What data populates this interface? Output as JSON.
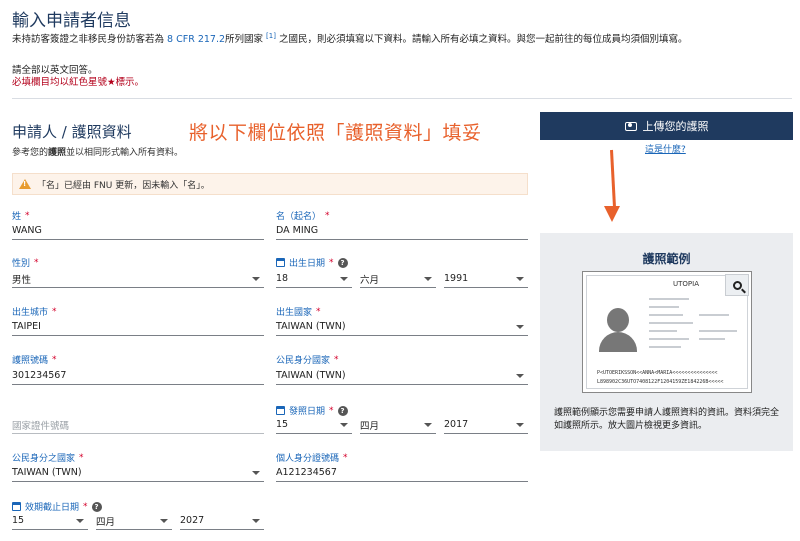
{
  "header": {
    "title": "輸入申請者信息",
    "intro_before": "未持訪客簽證之非移民身份訪客若為 ",
    "intro_link": "8 CFR 217.2",
    "intro_mid": "所列國家 ",
    "intro_ref": "[1]",
    "intro_after": " 之國民，則必須填寫以下資料。請輸入所有必填之資料。與您一起前往的每位成員均須個別填寫。",
    "note_english": "請全部以英文回答。",
    "note_required": "必填欄目均以紅色星號★標示。"
  },
  "section": {
    "title": "申請人 / 護照資料",
    "subtitle_pre": "參考您的",
    "subtitle_bold": "護照",
    "subtitle_post": "並以相同形式輸入所有資料。"
  },
  "annotation": "將以下欄位依照「護照資料」填妥",
  "upload": {
    "label": "上傳您的護照",
    "what_link": "這是什麼?"
  },
  "alert": {
    "text": "「名」已經由 FNU 更新，因未輸入「名」。"
  },
  "fields": {
    "surname": {
      "label": "姓",
      "value": "WANG"
    },
    "given_name": {
      "label": "名（起名）",
      "value": "DA MING"
    },
    "gender": {
      "label": "性別",
      "value": "男性"
    },
    "dob": {
      "label": "出生日期",
      "day": "18",
      "month": "六月",
      "year": "1991"
    },
    "birth_city": {
      "label": "出生城市",
      "value": "TAIPEI"
    },
    "birth_country": {
      "label": "出生國家",
      "value": "TAIWAN (TWN)"
    },
    "passport_no": {
      "label": "護照號碼",
      "value": "301234567"
    },
    "citizenship": {
      "label": "公民身分國家",
      "value": "TAIWAN (TWN)"
    },
    "national_doc": {
      "placeholder": "國家證件號碼"
    },
    "issue_date": {
      "label": "發照日期",
      "day": "15",
      "month": "四月",
      "year": "2017"
    },
    "issuing_country": {
      "label": "公民身分之國家",
      "value": "TAIWAN (TWN)"
    },
    "national_id": {
      "label": "個人身分證號碼",
      "value": "A121234567"
    },
    "expiry_date": {
      "label": "效期截止日期",
      "day": "15",
      "month": "四月",
      "year": "2027"
    }
  },
  "sample": {
    "title": "護照範例",
    "country": "UTOPIA",
    "mrz1": "P<UTOERIKSSON<<ANNA<MARIA<<<<<<<<<<<<<<<",
    "mrz2": "L898902C36UTO7408122F1204159ZE184226B<<<<<",
    "description": "護照範例顯示您需要申請人護照資料的資訊。資料須完全如護照所示。放大圖片檢視更多資訊。"
  },
  "colors": {
    "accent": "#1f3a5f",
    "link": "#1a66b8",
    "annotation": "#e8612c",
    "required": "#d4002a"
  }
}
